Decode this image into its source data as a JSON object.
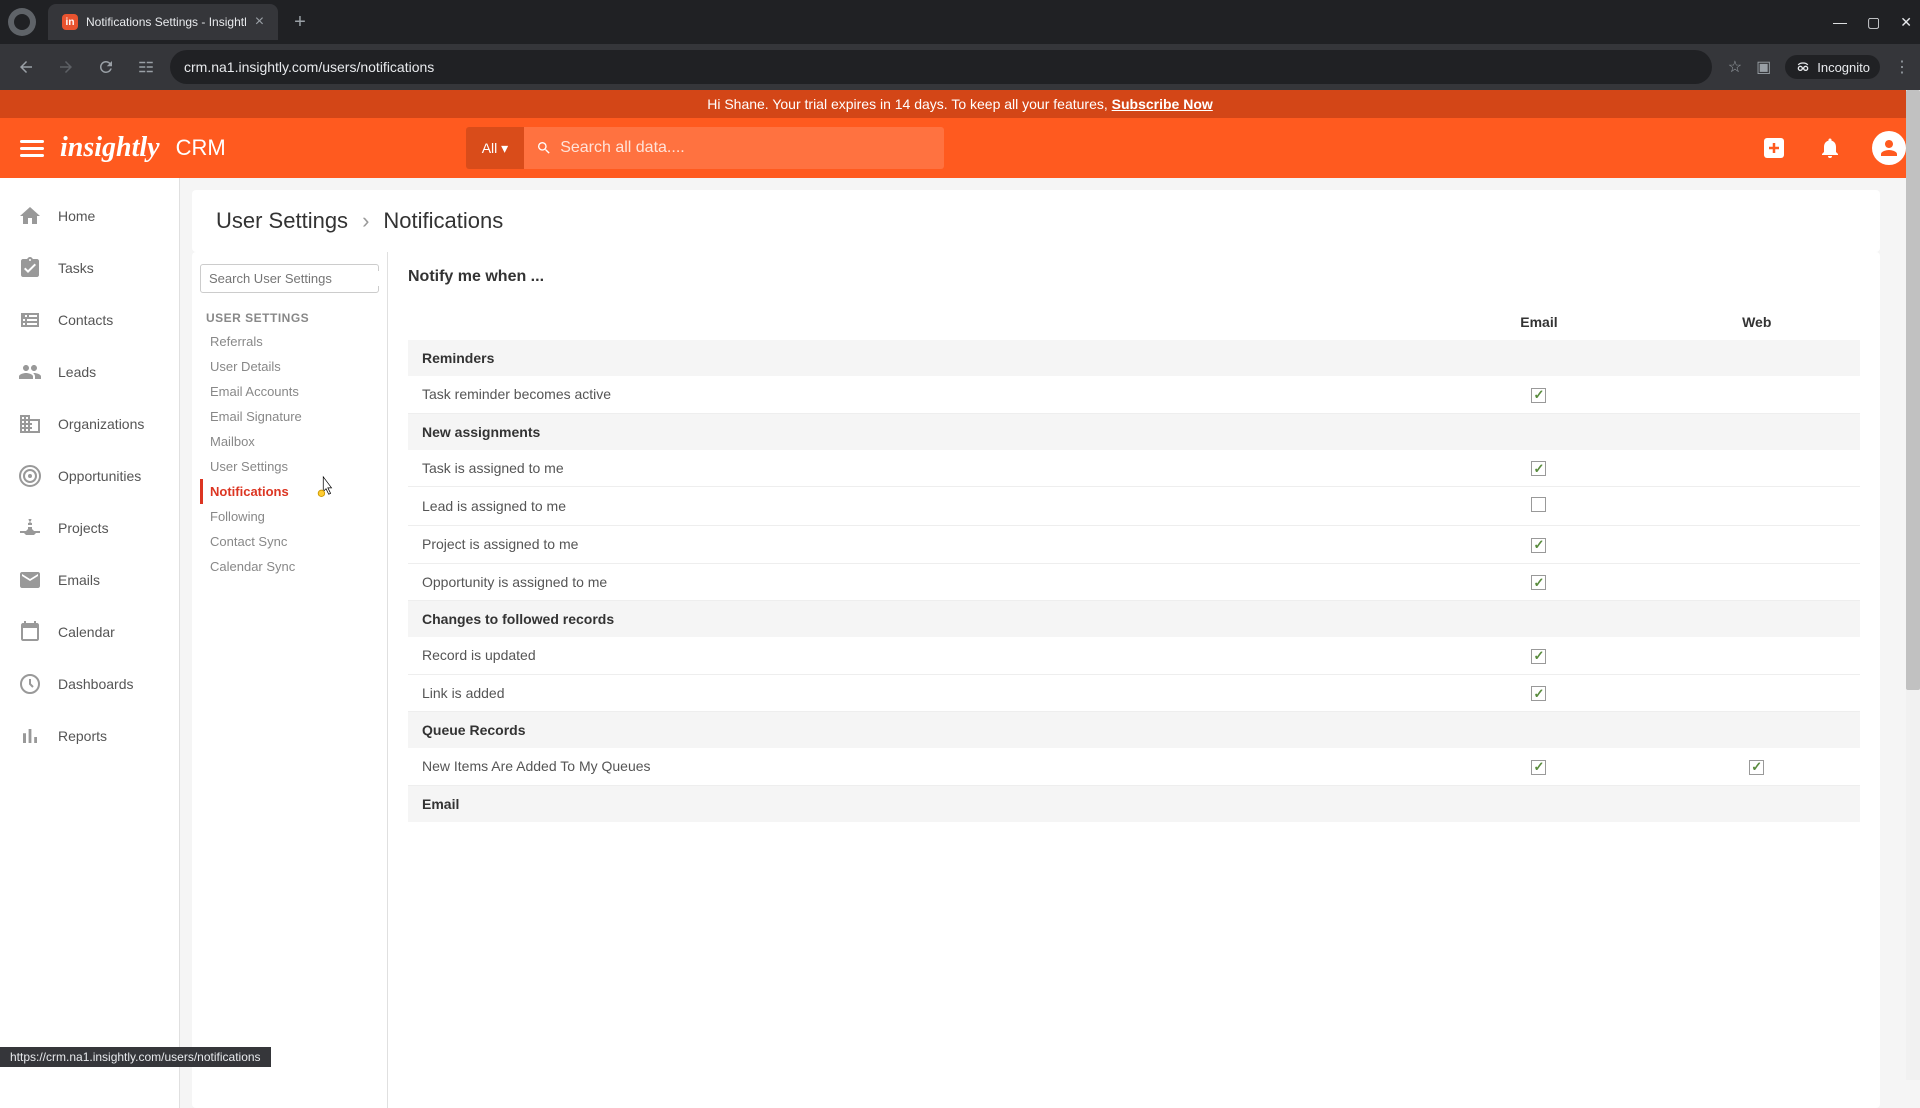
{
  "browser": {
    "tab_title": "Notifications Settings - Insightl",
    "url": "crm.na1.insightly.com/users/notifications",
    "incognito_label": "Incognito",
    "status_url": "https://crm.na1.insightly.com/users/notifications"
  },
  "banner": {
    "greeting": "Hi Shane. Your trial expires in 14 days. To keep all your features, ",
    "subscribe": "Subscribe Now"
  },
  "header": {
    "logo": "insightly",
    "crm": "CRM",
    "filter": "All",
    "search_placeholder": "Search all data...."
  },
  "nav": {
    "items": [
      {
        "label": "Home"
      },
      {
        "label": "Tasks"
      },
      {
        "label": "Contacts"
      },
      {
        "label": "Leads"
      },
      {
        "label": "Organizations"
      },
      {
        "label": "Opportunities"
      },
      {
        "label": "Projects"
      },
      {
        "label": "Emails"
      },
      {
        "label": "Calendar"
      },
      {
        "label": "Dashboards"
      },
      {
        "label": "Reports"
      }
    ]
  },
  "breadcrumb": {
    "parent": "User Settings",
    "current": "Notifications"
  },
  "settings_sidebar": {
    "search_placeholder": "Search User Settings",
    "header": "USER SETTINGS",
    "items": [
      {
        "label": "Referrals"
      },
      {
        "label": "User Details"
      },
      {
        "label": "Email Accounts"
      },
      {
        "label": "Email Signature"
      },
      {
        "label": "Mailbox"
      },
      {
        "label": "User Settings"
      },
      {
        "label": "Notifications",
        "active": true
      },
      {
        "label": "Following"
      },
      {
        "label": "Contact Sync"
      },
      {
        "label": "Calendar Sync"
      }
    ]
  },
  "notifications": {
    "title": "Notify me when ...",
    "columns": {
      "email": "Email",
      "web": "Web"
    },
    "groups": [
      {
        "header": "Reminders",
        "rows": [
          {
            "label": "Task reminder becomes active",
            "email": true,
            "web": null
          }
        ]
      },
      {
        "header": "New assignments",
        "rows": [
          {
            "label": "Task is assigned to me",
            "email": true,
            "web": null
          },
          {
            "label": "Lead is assigned to me",
            "email": false,
            "web": null
          },
          {
            "label": "Project is assigned to me",
            "email": true,
            "web": null
          },
          {
            "label": "Opportunity is assigned to me",
            "email": true,
            "web": null
          }
        ]
      },
      {
        "header": "Changes to followed records",
        "rows": [
          {
            "label": "Record is updated",
            "email": true,
            "web": null
          },
          {
            "label": "Link is added",
            "email": true,
            "web": null
          }
        ]
      },
      {
        "header": "Queue Records",
        "rows": [
          {
            "label": "New Items Are Added To My Queues",
            "email": true,
            "web": true
          }
        ]
      },
      {
        "header": "Email",
        "rows": []
      }
    ]
  }
}
